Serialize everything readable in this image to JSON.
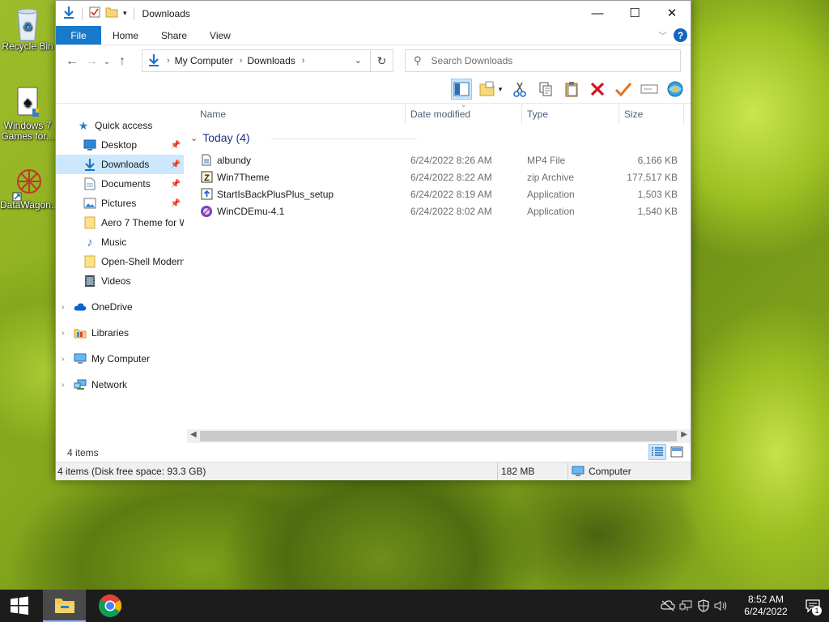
{
  "desktop": {
    "icons": [
      {
        "label": "Recycle Bin",
        "icon": "recycle-bin-icon"
      },
      {
        "label": "Windows 7 Games for...",
        "icon": "games-icon"
      },
      {
        "label": "DataWagon...",
        "icon": "datawagon-icon"
      }
    ]
  },
  "window": {
    "title": "Downloads",
    "ribbon_tabs": [
      "File",
      "Home",
      "Share",
      "View"
    ],
    "help_label": "?",
    "address": {
      "crumbs": [
        "My Computer",
        "Downloads"
      ]
    },
    "search": {
      "placeholder": "Search Downloads"
    },
    "nav_pane": {
      "quick_access": "Quick access",
      "items": [
        {
          "label": "Desktop",
          "pinned": true,
          "icon": "desktop-icon"
        },
        {
          "label": "Downloads",
          "pinned": true,
          "icon": "downloads-icon",
          "selected": true
        },
        {
          "label": "Documents",
          "pinned": true,
          "icon": "documents-icon"
        },
        {
          "label": "Pictures",
          "pinned": true,
          "icon": "pictures-icon"
        },
        {
          "label": "Aero 7 Theme for W",
          "pinned": false,
          "icon": "folder-icon"
        },
        {
          "label": "Music",
          "pinned": false,
          "icon": "music-icon"
        },
        {
          "label": "Open-Shell Modern",
          "pinned": false,
          "icon": "folder-icon"
        },
        {
          "label": "Videos",
          "pinned": false,
          "icon": "videos-icon"
        }
      ],
      "roots": [
        {
          "label": "OneDrive",
          "icon": "onedrive-icon"
        },
        {
          "label": "Libraries",
          "icon": "libraries-icon"
        },
        {
          "label": "My Computer",
          "icon": "computer-icon"
        },
        {
          "label": "Network",
          "icon": "network-icon"
        }
      ]
    },
    "columns": [
      "Name",
      "Date modified",
      "Type",
      "Size"
    ],
    "group": {
      "label": "Today (4)"
    },
    "files": [
      {
        "name": "albundy",
        "date": "6/24/2022 8:26 AM",
        "type": "MP4 File",
        "size": "6,166 KB",
        "icon": "video-file-icon"
      },
      {
        "name": "Win7Theme",
        "date": "6/24/2022 8:22 AM",
        "type": "zip Archive",
        "size": "177,517 KB",
        "icon": "zip-file-icon"
      },
      {
        "name": "StartIsBackPlusPlus_setup",
        "date": "6/24/2022 8:19 AM",
        "type": "Application",
        "size": "1,503 KB",
        "icon": "setup-app-icon"
      },
      {
        "name": "WinCDEmu-4.1",
        "date": "6/24/2022 8:02 AM",
        "type": "Application",
        "size": "1,540 KB",
        "icon": "wincdemu-app-icon"
      }
    ],
    "status": {
      "item_count": "4 items"
    },
    "details_bar": {
      "info": "4 items (Disk free space: 93.3 GB)",
      "size": "182 MB",
      "location": "Computer"
    }
  },
  "taskbar": {
    "clock_time": "8:52 AM",
    "clock_date": "6/24/2022",
    "notification_count": "1"
  }
}
